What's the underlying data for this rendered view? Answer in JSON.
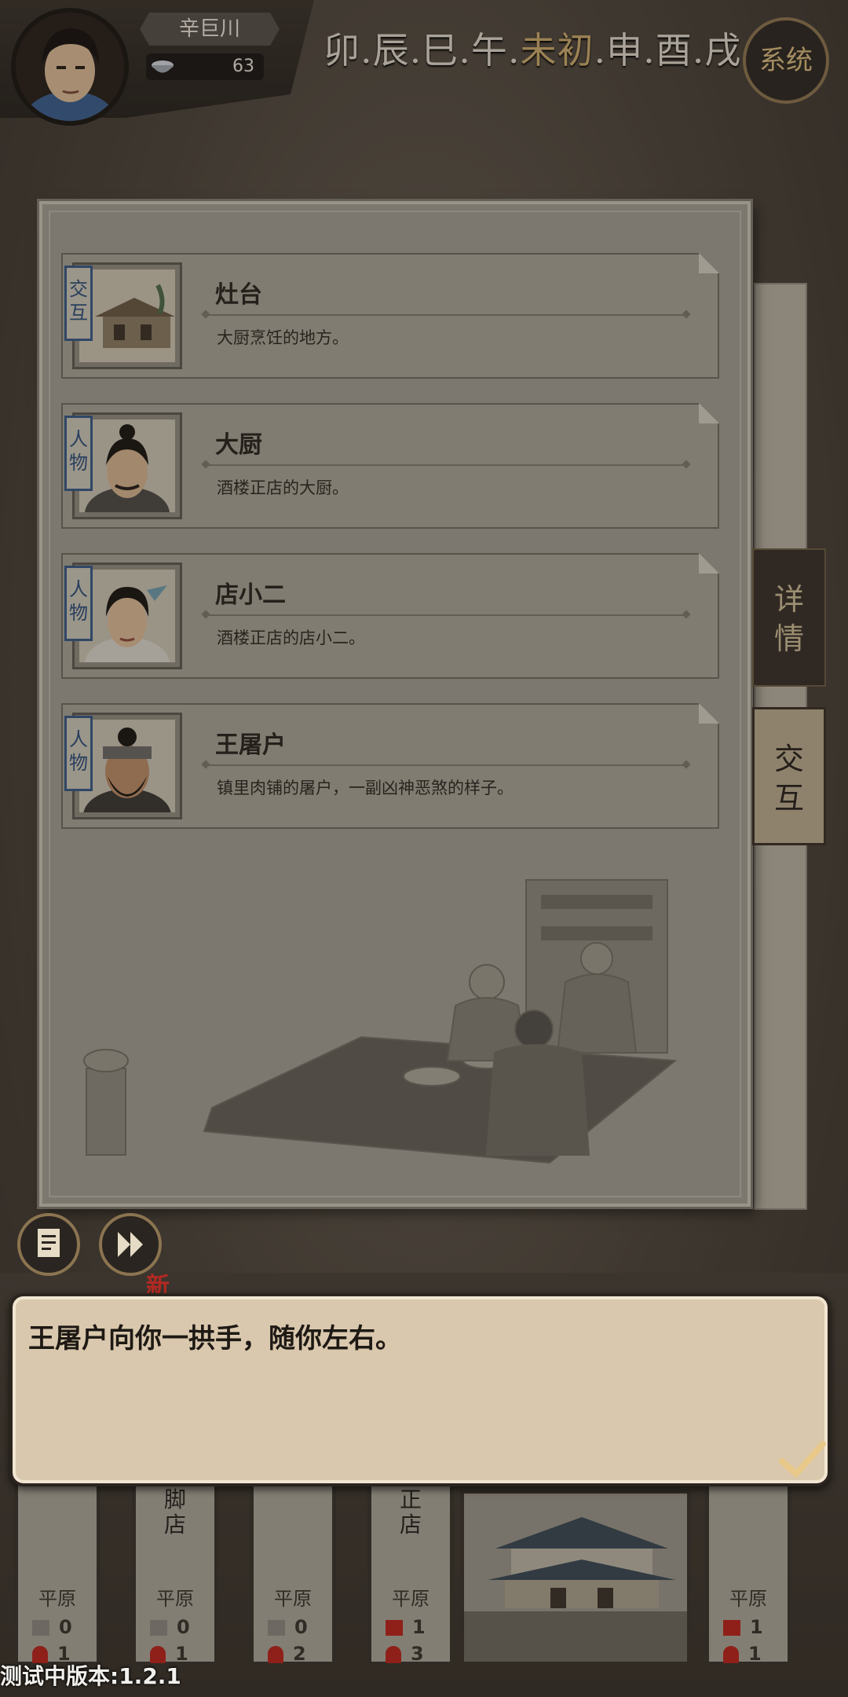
{
  "player": {
    "name": "辛巨川",
    "coins": "63",
    "avatar_icon": "portrait-icon",
    "coin_icon": "silver-bowl-icon"
  },
  "time": {
    "segments": [
      "卯",
      "辰",
      "巳",
      "午",
      "未初",
      "申",
      "酉",
      "戌"
    ],
    "current_index": 4
  },
  "system_button": "系统",
  "entries": [
    {
      "tag": "交互",
      "title": "灶台",
      "desc": "大厨烹饪的地方。",
      "icon": "stove-building-icon"
    },
    {
      "tag": "人物",
      "title": "大厨",
      "desc": "酒楼正店的大厨。",
      "icon": "chef-portrait-icon"
    },
    {
      "tag": "人物",
      "title": "店小二",
      "desc": "酒楼正店的店小二。",
      "icon": "waiter-portrait-icon"
    },
    {
      "tag": "人物",
      "title": "王屠户",
      "desc": "镇里肉铺的屠户，一副凶神恶煞的样子。",
      "icon": "butcher-portrait-icon"
    }
  ],
  "tabs": {
    "detail": "详情",
    "interact": "交互"
  },
  "buttons": {
    "log_icon": "log-icon",
    "skip_icon": "fast-forward-icon"
  },
  "new_badge": "新",
  "dialog": {
    "text": "王屠户向你一拱手，随你左右。",
    "confirm_icon": "checkmark-icon"
  },
  "map": {
    "locations": [
      {
        "name": "",
        "terrain": "平原",
        "flags": "0",
        "people": "1",
        "flag_active": false
      },
      {
        "name": "脚店",
        "terrain": "平原",
        "flags": "0",
        "people": "1",
        "flag_active": false
      },
      {
        "name": "",
        "terrain": "平原",
        "flags": "0",
        "people": "2",
        "flag_active": false
      },
      {
        "name": "正店",
        "terrain": "平原",
        "flags": "1",
        "people": "3",
        "flag_active": true
      },
      {
        "name": "",
        "terrain": "平原",
        "flags": "1",
        "people": "1",
        "flag_active": true
      }
    ]
  },
  "version": "测试中版本:1.2.1"
}
